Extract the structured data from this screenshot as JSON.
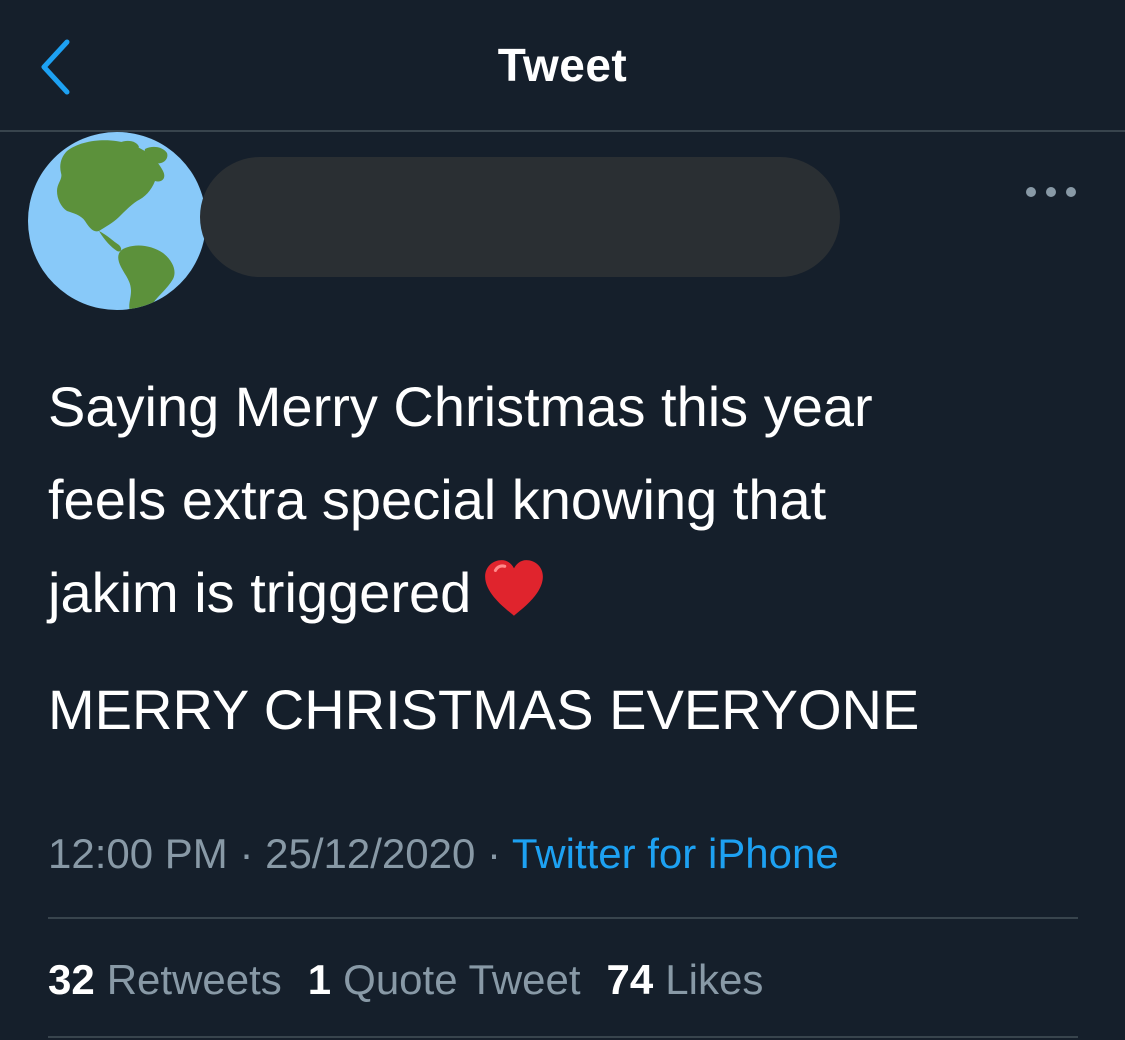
{
  "header": {
    "title": "Tweet",
    "back_icon": "chevron-left-icon"
  },
  "author": {
    "avatar_icon": "globe-americas-emoji",
    "more_icon": "ellipsis-icon"
  },
  "tweet": {
    "text_line1": "Saying Merry Christmas this year\nfeels extra special knowing that\njakim is triggered",
    "emoji": "red-heart-emoji",
    "text_line2": "MERRY CHRISTMAS EVERYONE"
  },
  "meta": {
    "time": "12:00 PM",
    "sep": " · ",
    "date": "25/12/2020",
    "source": "Twitter for iPhone"
  },
  "stats": {
    "retweets_count": "32",
    "retweets_label": "Retweets",
    "quotes_count": "1",
    "quotes_label": "Quote Tweet",
    "likes_count": "74",
    "likes_label": "Likes"
  },
  "colors": {
    "background": "#151f2b",
    "accent": "#1da1f2",
    "muted": "#8899a6",
    "divider": "#38444d"
  }
}
